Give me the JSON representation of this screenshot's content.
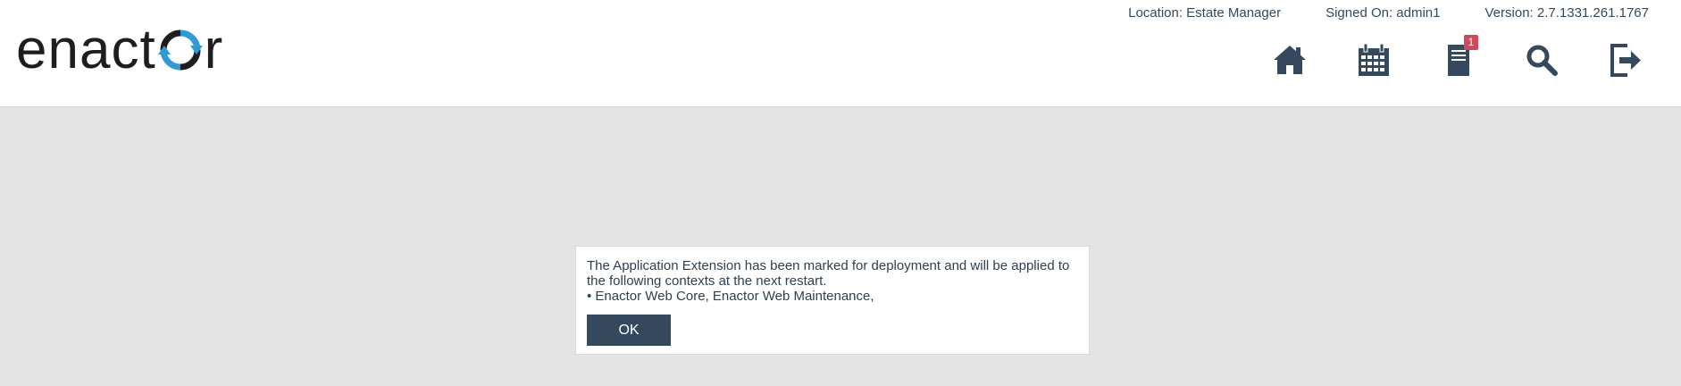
{
  "header": {
    "logo": {
      "text_before": "enact",
      "text_after": "r",
      "accent_color": "#2e9bd6"
    },
    "status": {
      "location": "Location: Estate Manager",
      "signed_on": "Signed On: admin1",
      "version": "Version: 2.7.1331.261.1767"
    },
    "nav": {
      "home_icon": "home-icon",
      "calendar_icon": "calendar-icon",
      "documents_icon": "documents-icon",
      "documents_badge": "1",
      "search_icon": "search-icon",
      "logout_icon": "logout-icon",
      "icon_color": "#34495e",
      "badge_color": "#cd4a5a"
    }
  },
  "dialog": {
    "lines": [
      "The Application Extension has been marked for deployment and will be applied to",
      "the following contexts at the next restart.",
      "• Enactor Web Core, Enactor Web Maintenance,"
    ],
    "ok_label": "OK",
    "button_color": "#34495e"
  },
  "background_color": "#e4e4e4"
}
